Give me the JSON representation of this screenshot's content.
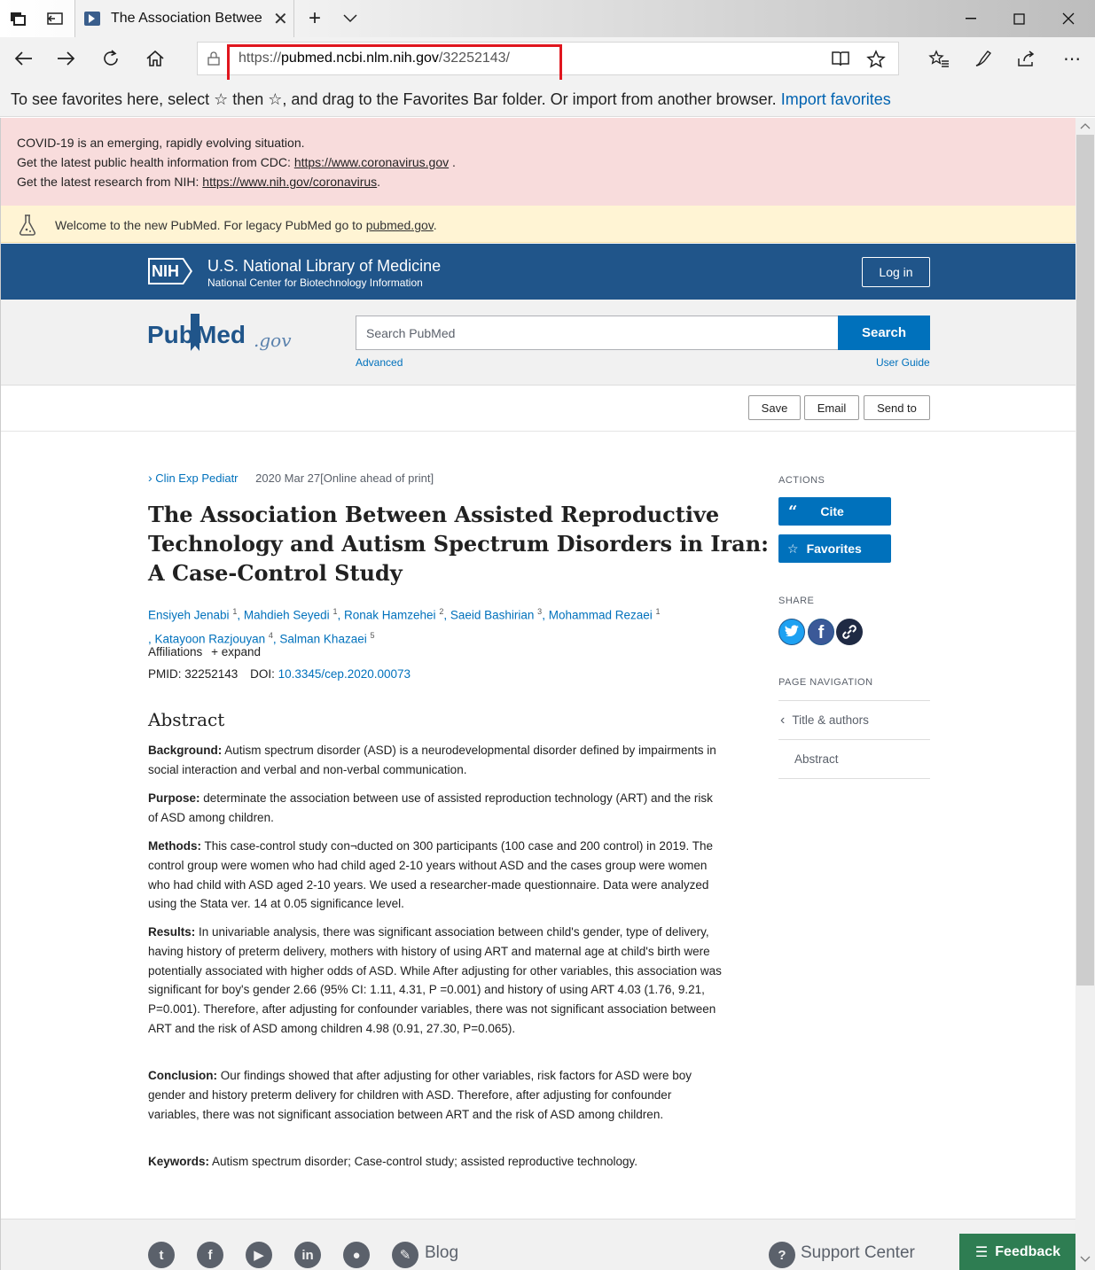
{
  "browser": {
    "tab_title": "The Association Betwee",
    "url_prefix": "https://",
    "url_domain": "pubmed.ncbi.nlm.nih.gov",
    "url_path": "/32252143/",
    "favbar_text": "To see favorites here, select ☆ then ☆, and drag to the Favorites Bar folder. Or import from another browser.",
    "favbar_link": "Import favorites"
  },
  "banner": {
    "line1": "COVID-19 is an emerging, rapidly evolving situation.",
    "line2_pre": "Get the latest public health information from CDC: ",
    "line2_link": "https://www.coronavirus.gov",
    "line2_post": " .",
    "line3_pre": "Get the latest research from NIH: ",
    "line3_link": "https://www.nih.gov/coronavirus",
    "line3_post": "."
  },
  "legacy": {
    "text_pre": "Welcome to the new PubMed. For legacy PubMed go to ",
    "link": "pubmed.gov",
    "text_post": "."
  },
  "nih": {
    "logo": "NIH",
    "title": "U.S. National Library of Medicine",
    "subtitle": "National Center for Biotechnology Information",
    "login": "Log in"
  },
  "search": {
    "logo_pub": "Pub",
    "logo_med": "Med",
    "logo_gov": ".gov",
    "placeholder": "Search PubMed",
    "button": "Search",
    "advanced": "Advanced",
    "user_guide": "User Guide"
  },
  "toolbar": {
    "save": "Save",
    "email": "Email",
    "send_to": "Send to"
  },
  "article": {
    "journal": "Clin Exp Pediatr",
    "date": "2020 Mar 27[Online ahead of print]",
    "title_l1": "The Association Between Assisted Reproductive",
    "title_l2": "Technology and Autism Spectrum Disorders in Iran:",
    "title_l3": "A Case-Control Study",
    "authors": [
      {
        "name": "Ensiyeh Jenabi",
        "sup": "1"
      },
      {
        "name": "Mahdieh Seyedi",
        "sup": "1"
      },
      {
        "name": "Ronak Hamzehei",
        "sup": "2"
      },
      {
        "name": "Saeid Bashirian",
        "sup": "3"
      },
      {
        "name": "Mohammad Rezaei",
        "sup": "1"
      },
      {
        "name": "Katayoon Razjouyan",
        "sup": "4"
      },
      {
        "name": "Salman Khazaei",
        "sup": "5"
      }
    ],
    "affiliations": "Affiliations",
    "expand": "expand",
    "pmid_label": "PMID: 32252143",
    "doi_label": "DOI:",
    "doi": "10.3345/cep.2020.00073",
    "abstract_heading": "Abstract",
    "background_label": "Background:",
    "background": " Autism spectrum disorder (ASD) is a neurodevelopmental disorder defined by impairments in social interaction and verbal and non-verbal communication.",
    "purpose_label": "Purpose:",
    "purpose": " determinate the association between use of assisted reproduction technology (ART) and the risk of ASD among children.",
    "methods_label": "Methods:",
    "methods": " This case-control study con¬ducted on 300 participants (100 case and 200 control) in 2019. The control group were women who had child aged 2-10 years without ASD and the cases group were women who had child with ASD aged 2-10 years. We used a researcher-made questionnaire. Data were analyzed using the Stata ver. 14 at 0.05 significance level.",
    "results_label": "Results:",
    "results": " In univariable analysis, there was significant association between child's gender, type of delivery, having history of preterm delivery, mothers with history of using ART and maternal age at child's birth were potentially associated with higher odds of ASD. While After adjusting for other variables, this association was significant for boy's gender 2.66 (95% CI: 1.11, 4.31, P =0.001) and history of using ART 4.03 (1.76, 9.21, P=0.001). Therefore, after adjusting for confounder variables, there was not significant association between ART and the risk of ASD among children 4.98 (0.91, 27.30, P=0.065).",
    "conclusion_label": "Conclusion:",
    "conclusion": " Our findings showed that after adjusting for other variables, risk factors for ASD were boy gender and history preterm delivery for children with ASD. Therefore, after adjusting for confounder variables, there was not significant association between ART and the risk of ASD among children.",
    "keywords_label": "Keywords:",
    "keywords": " Autism spectrum disorder; Case-control study; assisted reproductive technology."
  },
  "sidebar": {
    "actions": "ACTIONS",
    "cite": "Cite",
    "favorites": "Favorites",
    "share": "SHARE",
    "page_nav": "PAGE NAVIGATION",
    "nav_items": [
      "Title & authors",
      "Abstract"
    ]
  },
  "footer": {
    "blog": "Blog",
    "support": "Support Center",
    "feedback": "Feedback"
  }
}
